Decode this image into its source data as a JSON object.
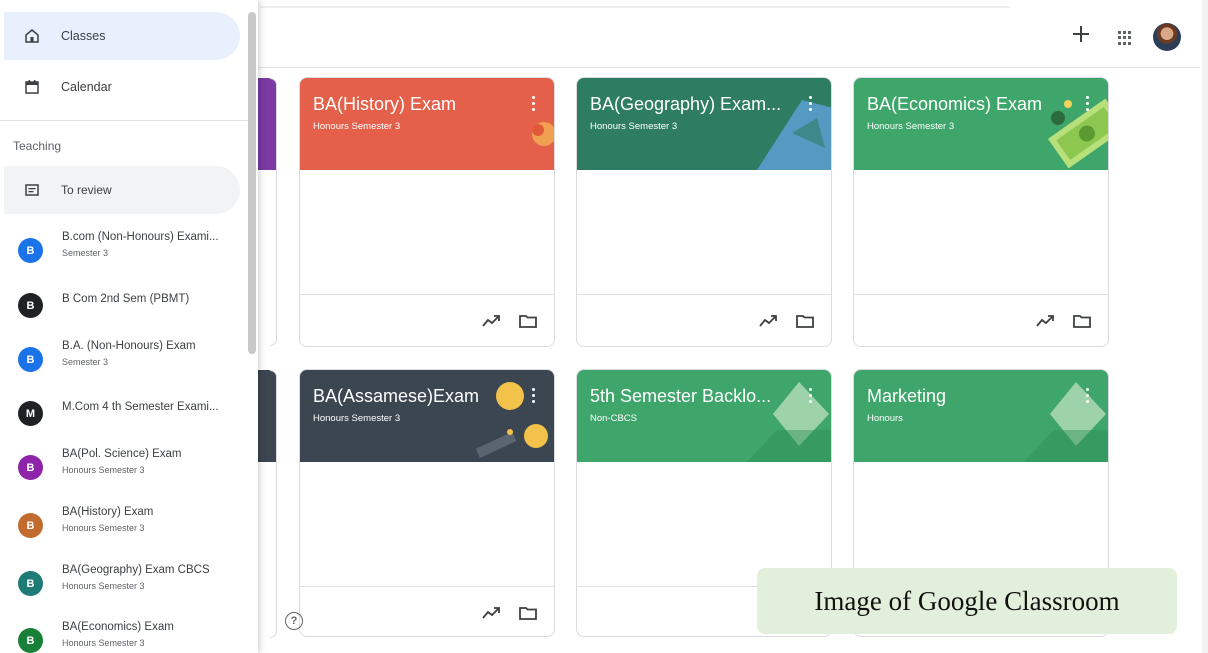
{
  "nav": [
    {
      "label": "Classes",
      "icon": "home-icon",
      "active": true
    },
    {
      "label": "Calendar",
      "icon": "calendar-icon",
      "active": false
    }
  ],
  "teaching_label": "Teaching",
  "to_review": {
    "label": "To review",
    "icon": "review-icon"
  },
  "sidebar_classes": [
    {
      "initial": "B",
      "name": "B.com (Non-Honours) Exami...",
      "subtitle": "Semester 3",
      "color": "#1a73e8"
    },
    {
      "initial": "B",
      "name": "B Com 2nd Sem (PBMT)",
      "subtitle": "",
      "color": "#202124"
    },
    {
      "initial": "B",
      "name": "B.A. (Non-Honours) Exam",
      "subtitle": "Semester 3",
      "color": "#1a73e8"
    },
    {
      "initial": "M",
      "name": "M.Com 4 th Semester Exami...",
      "subtitle": "",
      "color": "#202124"
    },
    {
      "initial": "B",
      "name": "BA(Pol. Science) Exam",
      "subtitle": "Honours Semester 3",
      "color": "#8e24aa"
    },
    {
      "initial": "B",
      "name": "BA(History) Exam",
      "subtitle": "Honours Semester 3",
      "color": "#c26b2e"
    },
    {
      "initial": "B",
      "name": "BA(Geography) Exam CBCS",
      "subtitle": "Honours Semester 3",
      "color": "#1e7b75"
    },
    {
      "initial": "B",
      "name": "BA(Economics) Exam",
      "subtitle": "Honours Semester 3",
      "color": "#188038"
    }
  ],
  "cards": [
    {
      "title": "BA(History) Exam",
      "subtitle": "Honours Semester 3",
      "color": "#e4604a",
      "footer": true
    },
    {
      "title": "BA(Geography) Exam...",
      "subtitle": "Honours Semester 3",
      "color": "#2e7d63",
      "footer": true
    },
    {
      "title": "BA(Economics) Exam",
      "subtitle": "Honours Semester 3",
      "color": "#3ea56b",
      "footer": true
    },
    {
      "title": "BA(Assamese)Exam",
      "subtitle": "Honours Semester 3",
      "color": "#3c4650",
      "footer": true
    },
    {
      "title": "5th Semester Backlo...",
      "subtitle": "Non-CBCS",
      "color": "#3ea56b",
      "footer": false
    },
    {
      "title": "Marketing",
      "subtitle": "Honours",
      "color": "#3ea56b",
      "footer": false
    }
  ],
  "caption": "Image of Google Classroom",
  "help_glyph": "?"
}
